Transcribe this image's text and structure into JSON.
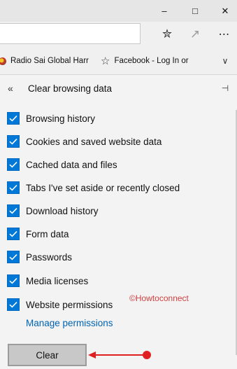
{
  "window": {
    "minimize_glyph": "–",
    "maximize_glyph": "□",
    "close_glyph": "✕"
  },
  "toolbar": {
    "address_value": "",
    "icons": {
      "favorites_hub": "favorites-star-icon",
      "share": "share-icon",
      "more": "more-icon"
    },
    "favorites_glyph": "✮",
    "share_glyph": "↗",
    "more_glyph": "⋯"
  },
  "favorites_bar": {
    "items": [
      {
        "label": "Radio Sai Global Harr",
        "icon": "radio-sai-favicon"
      },
      {
        "label": "Facebook - Log In or",
        "icon": "star-outline-icon"
      }
    ],
    "star_glyph": "☆",
    "chevron_glyph": "∨"
  },
  "panel": {
    "back_glyph": "«",
    "title": "Clear browsing data",
    "pin_glyph": "⊣",
    "options": [
      {
        "label": "Browsing history",
        "checked": true
      },
      {
        "label": "Cookies and saved website data",
        "checked": true
      },
      {
        "label": "Cached data and files",
        "checked": true
      },
      {
        "label": "Tabs I've set aside or recently closed",
        "checked": true
      },
      {
        "label": "Download history",
        "checked": true
      },
      {
        "label": "Form data",
        "checked": true
      },
      {
        "label": "Passwords",
        "checked": true
      },
      {
        "label": "Media licenses",
        "checked": true
      },
      {
        "label": "Website permissions",
        "checked": true
      }
    ],
    "manage_link": "Manage permissions",
    "clear_button": "Clear"
  },
  "watermark": "©Howtoconnect",
  "colors": {
    "checkbox": "#0078d7",
    "link": "#0063b1",
    "annotation": "#e02020",
    "watermark": "#d04040"
  }
}
